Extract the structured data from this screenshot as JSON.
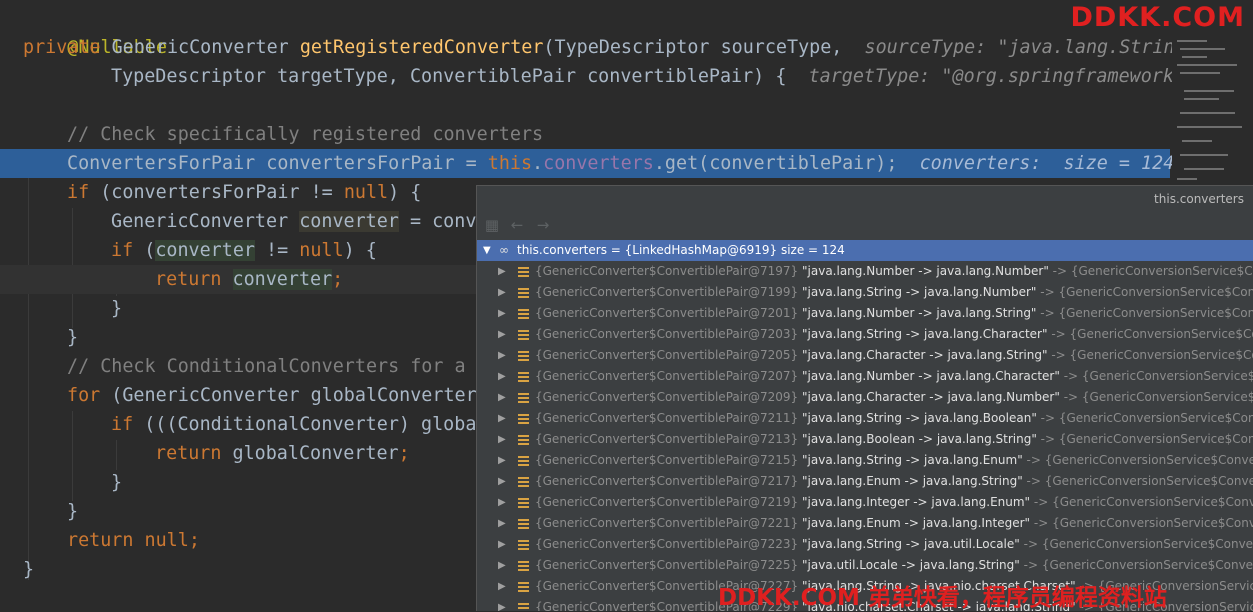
{
  "code": {
    "line1": {
      "annotation": "@Nullable"
    },
    "line2": {
      "kw_private": "private",
      "type1": "GenericConverter ",
      "method": "getRegisteredConverter",
      "params": "(TypeDescriptor sourceType,",
      "hint": "sourceType: \"java.lang.Strin"
    },
    "line3": {
      "params": "TypeDescriptor targetType, ConvertiblePair convertiblePair) {",
      "hint": "targetType: \"@org.springframework"
    },
    "line4": {
      "comment": "// Check specifically registered converters"
    },
    "line5": {
      "decl": "ConvertersForPair convertersForPair = ",
      "kw_this": "this",
      "dot": ".",
      "field": "converters",
      "rest": ".get(convertiblePair);",
      "hint": "converters:  size = 124"
    },
    "line6": {
      "kw_if": "if",
      "cond": " (convertersForPair != ",
      "kw_null": "null",
      "end": ") {"
    },
    "line7": {
      "type": "GenericConverter ",
      "var": "converter",
      "rest": " = conv"
    },
    "line8": {
      "kw_if": "if",
      "open": " (",
      "var": "converter",
      "cond": " != ",
      "kw_null": "null",
      "end": ") {"
    },
    "line9": {
      "kw_return": "return",
      "space": " ",
      "var": "converter",
      "semi": ";"
    },
    "line10": {
      "brace": "}"
    },
    "line11": {
      "brace": "}"
    },
    "line12": {
      "comment": "// Check ConditionalConverters for a"
    },
    "line13": {
      "kw_for": "for",
      "rest": " (GenericConverter globalConverter"
    },
    "line14": {
      "kw_if": "if",
      "rest": " (((ConditionalConverter) globa"
    },
    "line15": {
      "kw_return": "return",
      "rest": " globalConverter",
      "semi": ";"
    },
    "line16": {
      "brace": "}"
    },
    "line17": {
      "brace": "}"
    },
    "line18": {
      "kw_return": "return",
      "kw_null": " null",
      "semi": ";"
    },
    "line19": {
      "brace": "}"
    }
  },
  "watermark": {
    "top": "DDKK.COM",
    "bottom": "DDKK.COM 弟弟快看，程序员编程资料站"
  },
  "popup": {
    "title": "this.converters",
    "root": "this.converters = {LinkedHashMap@6919}  size = 124",
    "rows": [
      {
        "obj": "{GenericConverter$ConvertiblePair@7197}",
        "val": "\"java.lang.Number -> java.lang.Number\"",
        "target": "{GenericConversionService$Converte"
      },
      {
        "obj": "{GenericConverter$ConvertiblePair@7199}",
        "val": "\"java.lang.String -> java.lang.Number\"",
        "target": "{GenericConversionService$ConvertersF"
      },
      {
        "obj": "{GenericConverter$ConvertiblePair@7201}",
        "val": "\"java.lang.Number -> java.lang.String\"",
        "target": "{GenericConversionService$ConvertersF"
      },
      {
        "obj": "{GenericConverter$ConvertiblePair@7203}",
        "val": "\"java.lang.String -> java.lang.Character\"",
        "target": "{GenericConversionService$Converter"
      },
      {
        "obj": "{GenericConverter$ConvertiblePair@7205}",
        "val": "\"java.lang.Character -> java.lang.String\"",
        "target": "{GenericConversionService$Converter"
      },
      {
        "obj": "{GenericConverter$ConvertiblePair@7207}",
        "val": "\"java.lang.Number -> java.lang.Character\"",
        "target": "{GenericConversionService$Convert"
      },
      {
        "obj": "{GenericConverter$ConvertiblePair@7209}",
        "val": "\"java.lang.Character -> java.lang.Number\"",
        "target": "{GenericConversionService$Convert"
      },
      {
        "obj": "{GenericConverter$ConvertiblePair@7211}",
        "val": "\"java.lang.String -> java.lang.Boolean\"",
        "target": "{GenericConversionService$ConvertersF"
      },
      {
        "obj": "{GenericConverter$ConvertiblePair@7213}",
        "val": "\"java.lang.Boolean -> java.lang.String\"",
        "target": "{GenericConversionService$ConvertersF"
      },
      {
        "obj": "{GenericConverter$ConvertiblePair@7215}",
        "val": "\"java.lang.String -> java.lang.Enum\"",
        "target": "{GenericConversionService$ConvertersFo"
      },
      {
        "obj": "{GenericConverter$ConvertiblePair@7217}",
        "val": "\"java.lang.Enum -> java.lang.String\"",
        "target": "{GenericConversionService$ConvertersFo"
      },
      {
        "obj": "{GenericConverter$ConvertiblePair@7219}",
        "val": "\"java.lang.Integer -> java.lang.Enum\"",
        "target": "{GenericConversionService$ConvertersFo"
      },
      {
        "obj": "{GenericConverter$ConvertiblePair@7221}",
        "val": "\"java.lang.Enum -> java.lang.Integer\"",
        "target": "{GenericConversionService$ConvertersF"
      },
      {
        "obj": "{GenericConverter$ConvertiblePair@7223}",
        "val": "\"java.lang.String -> java.util.Locale\"",
        "target": "{GenericConversionService$ConvertersFor"
      },
      {
        "obj": "{GenericConverter$ConvertiblePair@7225}",
        "val": "\"java.util.Locale -> java.lang.String\"",
        "target": "{GenericConversionService$ConvertersFor"
      },
      {
        "obj": "{GenericConverter$ConvertiblePair@7227}",
        "val": "\"java.lang.String -> java.nio.charset.Charset\"",
        "target": "{GenericConversionService$Conv"
      },
      {
        "obj": "{GenericConverter$ConvertiblePair@7229}",
        "val": "\"java.nio.charset.Charset -> java.lang.String\"",
        "target": "{GenericConversionService"
      }
    ]
  },
  "icons": {
    "expand": "▼",
    "collapse": "▶",
    "back": "←",
    "forward": "→",
    "watch": "∞"
  }
}
